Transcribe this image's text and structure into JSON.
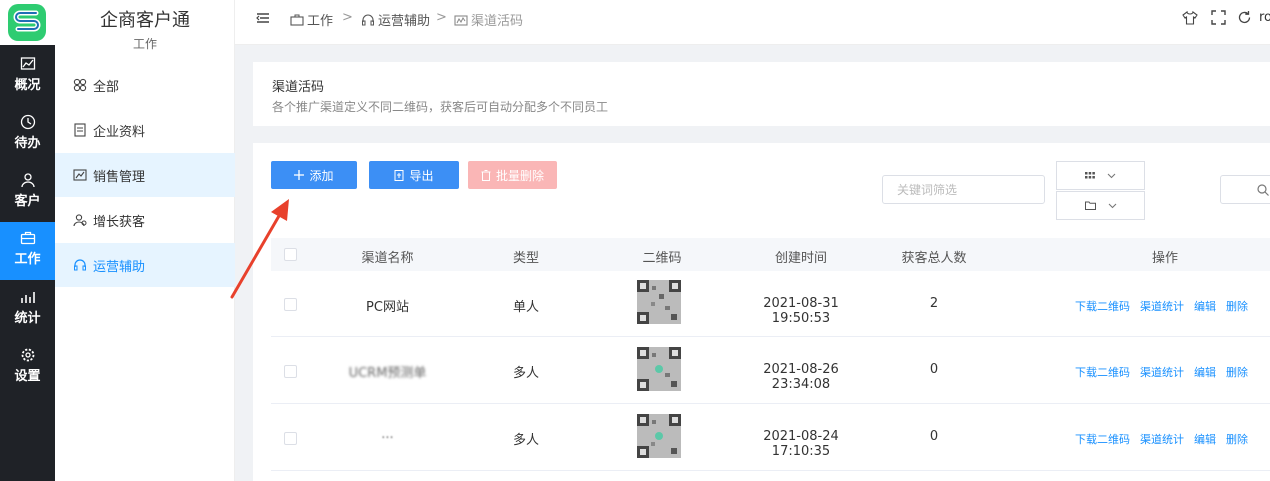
{
  "rail": {
    "items": [
      {
        "label": "概况",
        "icon": "chart-icon"
      },
      {
        "label": "待办",
        "icon": "clock-icon"
      },
      {
        "label": "客户",
        "icon": "user-icon"
      },
      {
        "label": "工作",
        "icon": "briefcase-icon"
      },
      {
        "label": "统计",
        "icon": "stats-icon"
      },
      {
        "label": "设置",
        "icon": "gear-icon"
      }
    ],
    "active_color": "#1890ff"
  },
  "subnav": {
    "app_title": "企商客户通",
    "section": "工作",
    "items": [
      {
        "label": "全部"
      },
      {
        "label": "企业资料"
      },
      {
        "label": "销售管理"
      },
      {
        "label": "增长获客"
      },
      {
        "label": "运营辅助"
      }
    ]
  },
  "header": {
    "breadcrumb": [
      "工作",
      "运营辅助",
      "渠道活码"
    ],
    "user": "ro"
  },
  "page": {
    "title": "渠道活码",
    "description": "各个推广渠道定义不同二维码，获客后可自动分配多个不同员工"
  },
  "toolbar": {
    "add_label": "添加",
    "export_label": "导出",
    "batch_delete_label": "批量删除",
    "filter_placeholder": "关键词筛选"
  },
  "table": {
    "columns": [
      "渠道名称",
      "类型",
      "二维码",
      "创建时间",
      "获客总人数",
      "操作"
    ],
    "rows": [
      {
        "name": "PC网站",
        "type": "单人",
        "created": "2021-08-31 19:50:53",
        "count": "2"
      },
      {
        "name": "UCRM预测单",
        "type": "多人",
        "created": "2021-08-26 23:34:08",
        "count": "0"
      },
      {
        "name": "...",
        "type": "多人",
        "created": "2021-08-24 17:10:35",
        "count": "0"
      }
    ],
    "actions": [
      "下载二维码",
      "渠道统计",
      "编辑",
      "删除"
    ]
  },
  "colors": {
    "primary": "#1890ff",
    "danger_disabled": "#fab6b6",
    "annotation_arrow": "#e8412c"
  }
}
